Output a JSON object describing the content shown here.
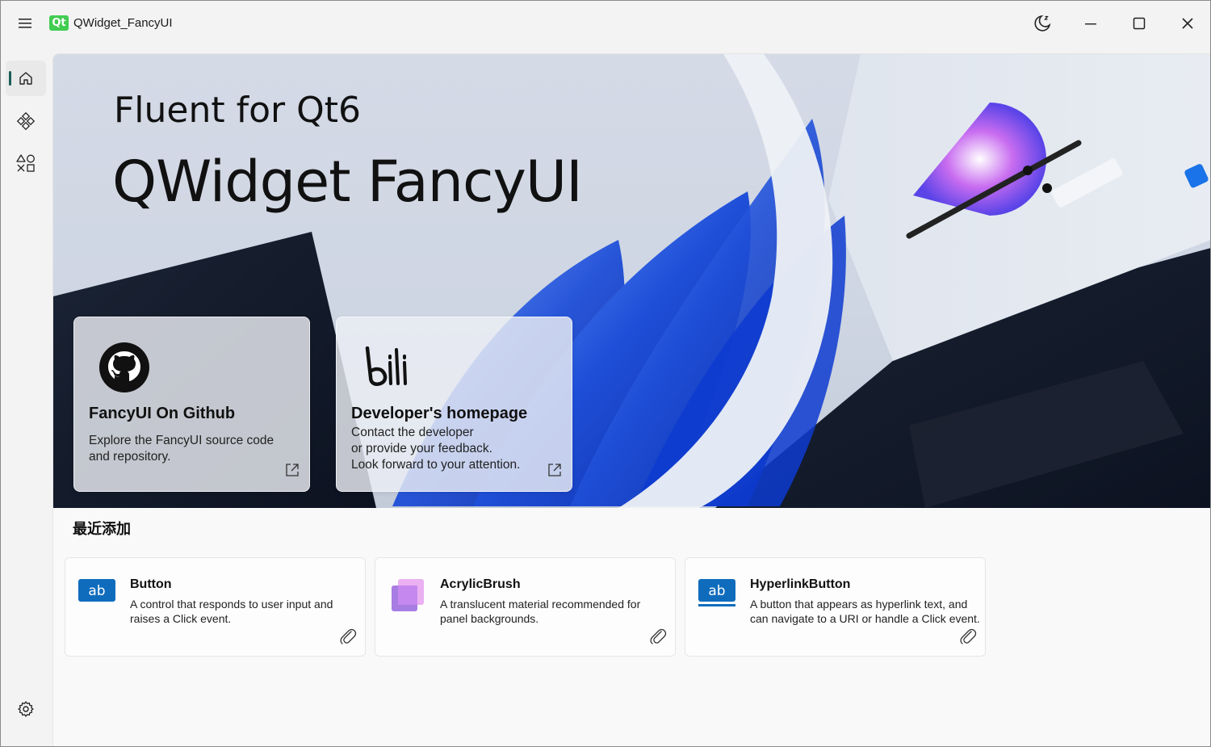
{
  "window": {
    "logo_text": "Qt",
    "title": "QWidget_FancyUI"
  },
  "titlebar_icons": [
    "hamburger-menu-icon",
    "theme-moon-icon",
    "minimize-icon",
    "maximize-icon",
    "close-icon"
  ],
  "sidebar": {
    "items": [
      {
        "name": "home",
        "icon": "home-icon",
        "active": true
      },
      {
        "name": "components",
        "icon": "components-icon",
        "active": false
      },
      {
        "name": "shapes",
        "icon": "shapes-icon",
        "active": false
      }
    ],
    "footer_icon": "settings-gear-icon"
  },
  "hero": {
    "subtitle": "Fluent for Qt6",
    "title": "QWidget FancyUI",
    "cards": [
      {
        "title": "FancyUI On Github",
        "desc": [
          "Explore the FancyUI source code",
          "and repository."
        ],
        "icon": "github-icon"
      },
      {
        "title": "Developer's homepage",
        "desc": [
          "Contact the developer",
          "or provide your feedback.",
          "Look forward to your attention."
        ],
        "icon": "bilibili-icon"
      }
    ]
  },
  "recent": {
    "heading": "最近添加",
    "items": [
      {
        "title": "Button",
        "desc": "A control that responds to user input and raises a Click event.",
        "icon_text": "ab"
      },
      {
        "title": "AcrylicBrush",
        "desc": "A translucent material recommended for panel backgrounds.",
        "icon_text": ""
      },
      {
        "title": "HyperlinkButton",
        "desc": "A button that appears as hyperlink text, and can navigate to a URI or handle a Click event.",
        "icon_text": "ab"
      }
    ]
  },
  "colors": {
    "accent": "#0f6cbd",
    "nav_indicator": "#1b5e5a",
    "qt_green": "#41cd52"
  }
}
